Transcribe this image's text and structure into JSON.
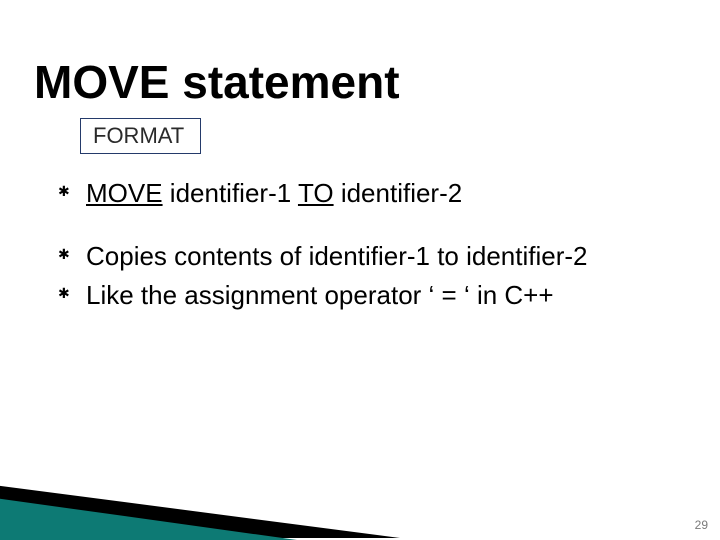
{
  "title": "MOVE statement",
  "format_label": "FORMAT",
  "syntax": {
    "keyword_move": "MOVE",
    "arg1": " identifier-1 ",
    "keyword_to": "TO",
    "arg2": " identifier-2"
  },
  "bullets": [
    "Copies contents of identifier-1 to identifier-2",
    "Like the assignment operator ‘ = ‘ in C++"
  ],
  "page_number": "29"
}
